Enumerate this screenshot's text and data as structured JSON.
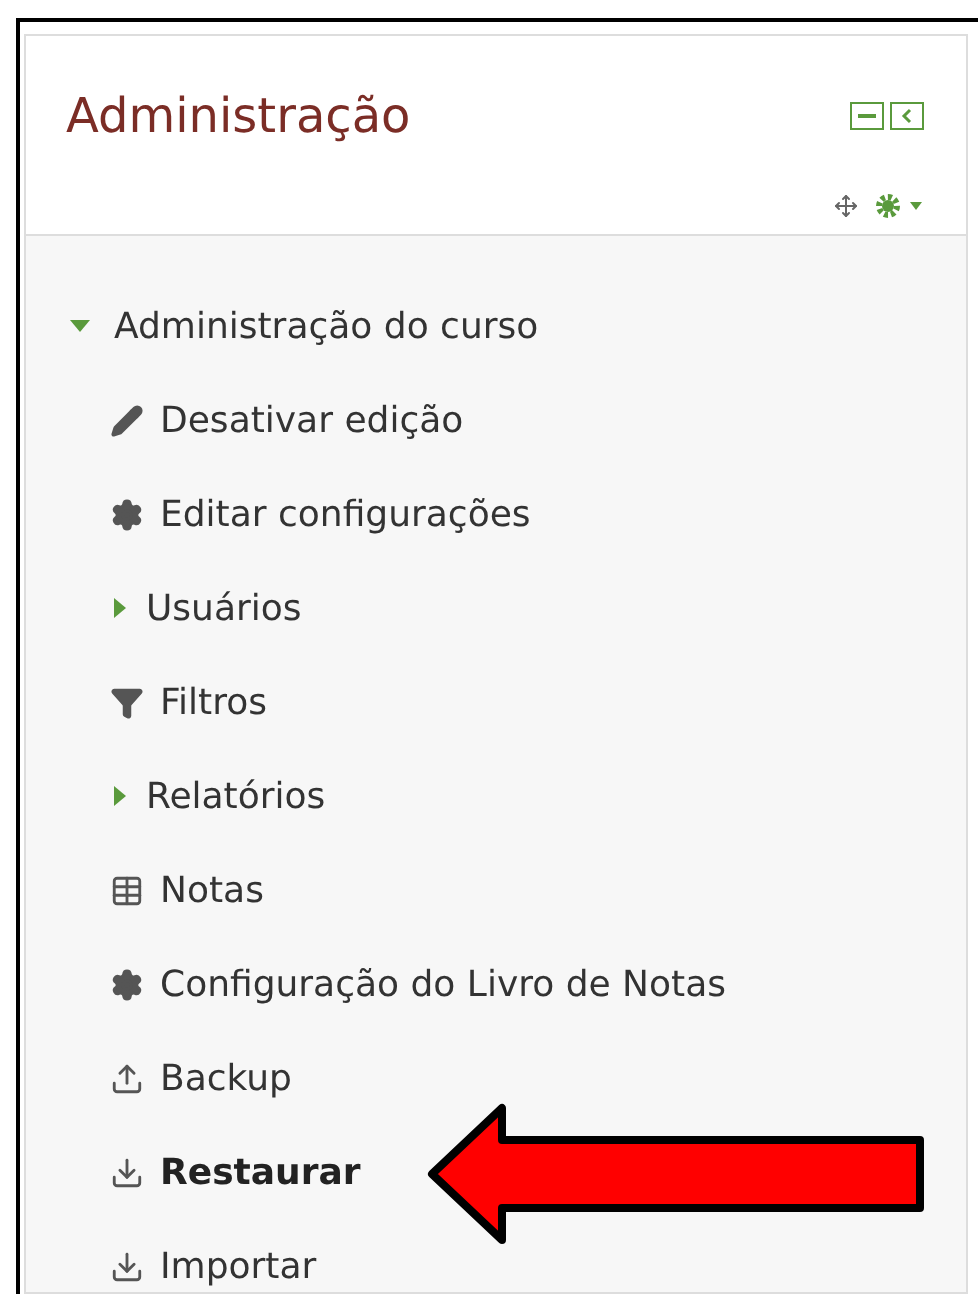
{
  "block": {
    "title": "Administração"
  },
  "tree": {
    "label": "Administração do curso",
    "expanded": true,
    "children": [
      {
        "kind": "edit",
        "label": "Desativar edição",
        "selected": false
      },
      {
        "kind": "settings",
        "label": "Editar configurações",
        "selected": false
      },
      {
        "kind": "branch",
        "label": "Usuários",
        "expanded": false,
        "selected": false
      },
      {
        "kind": "filter",
        "label": "Filtros",
        "selected": false
      },
      {
        "kind": "branch",
        "label": "Relatórios",
        "expanded": false,
        "selected": false
      },
      {
        "kind": "grades",
        "label": "Notas",
        "selected": false
      },
      {
        "kind": "settings",
        "label": "Configuração do Livro de Notas",
        "selected": false
      },
      {
        "kind": "upload",
        "label": "Backup",
        "selected": false
      },
      {
        "kind": "download",
        "label": "Restaurar",
        "selected": true
      },
      {
        "kind": "download",
        "label": "Importar",
        "selected": false
      }
    ]
  }
}
